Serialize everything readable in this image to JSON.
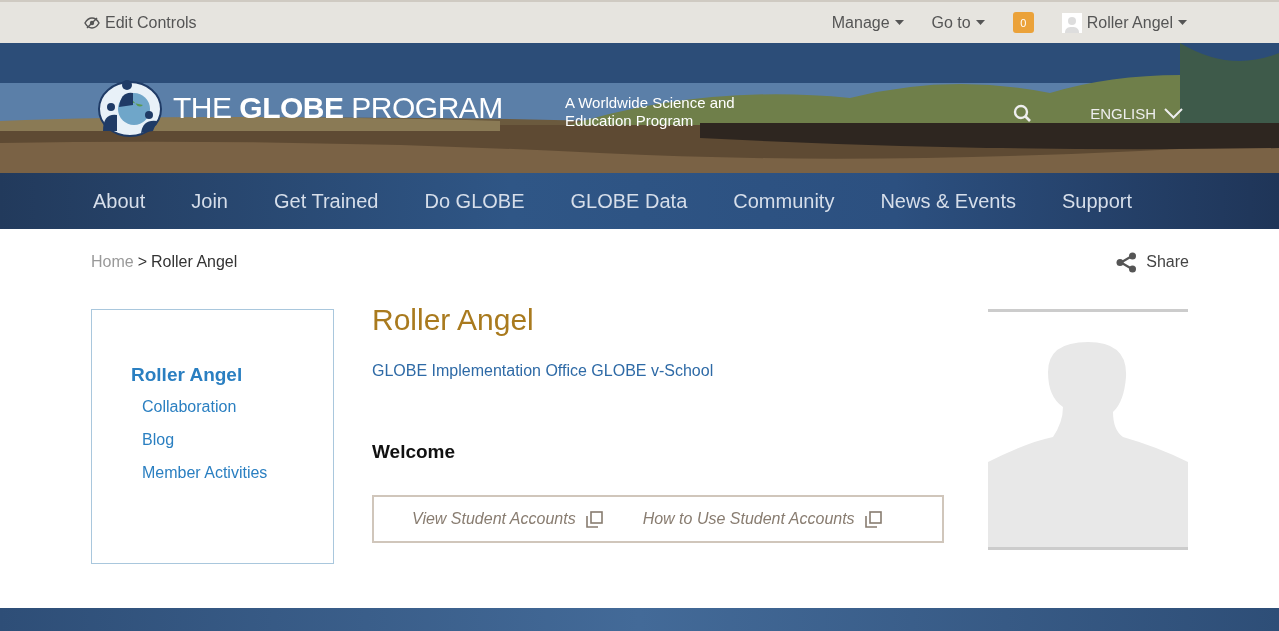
{
  "top_bar": {
    "edit_controls": "Edit Controls",
    "menus": [
      {
        "label": "Manage"
      },
      {
        "label": "Go to"
      }
    ],
    "notifications": "0",
    "user": "Roller Angel"
  },
  "header": {
    "logo": "THE **GLOBE** PROGRAM",
    "tagline": "A Worldwide Science and Education Program",
    "language": "ENGLISH"
  },
  "nav": [
    "About",
    "Join",
    "Get Trained",
    "Do GLOBE",
    "GLOBE Data",
    "Community",
    "News & Events",
    "Support"
  ],
  "breadcrumb": {
    "items": [
      "Home"
    ],
    "separator": ">",
    "current": "Roller Angel"
  },
  "share": "Share",
  "sidebar": {
    "title": "Roller Angel",
    "items": [
      "Collaboration",
      "Blog",
      "Member Activities"
    ]
  },
  "profile": {
    "name": "Roller Angel",
    "affiliation": "GLOBE Implementation Office GLOBE v-School",
    "heading": "Welcome",
    "links": [
      "View Student Accounts",
      "How to Use Student Accounts"
    ]
  }
}
